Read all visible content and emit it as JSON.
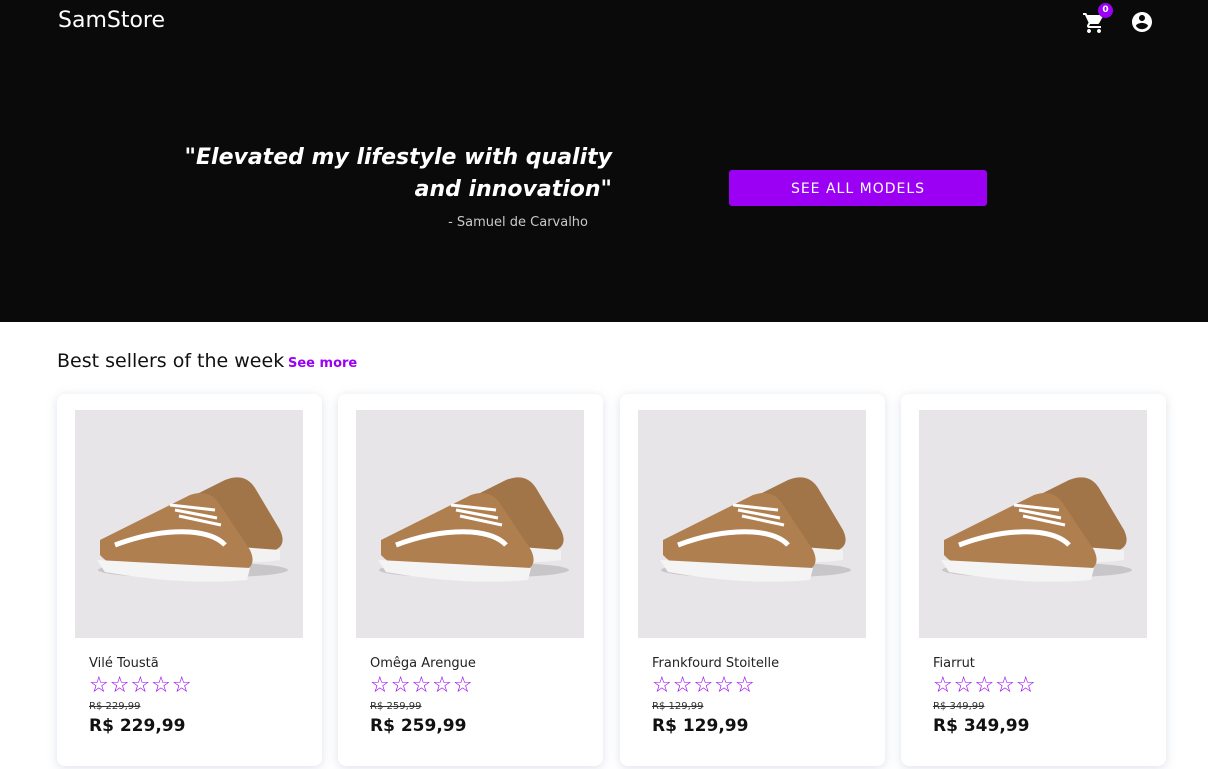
{
  "header": {
    "logo": "SamStore",
    "cart_count": "0",
    "cart_icon": "cart-icon",
    "account_icon": "account-circle-icon"
  },
  "hero": {
    "quote": "\"Elevated my lifestyle with quality and innovation\"",
    "author": "- Samuel de Carvalho",
    "cta_label": "SEE ALL MODELS"
  },
  "best_sellers": {
    "title": "Best sellers of the week",
    "see_more": "See more",
    "products": [
      {
        "name": "Vilé Toustã",
        "stars": "☆☆☆☆☆",
        "old_price": "R$ 229,99",
        "price": "R$ 229,99"
      },
      {
        "name": "Omêga Arengue",
        "stars": "☆☆☆☆☆",
        "old_price": "R$ 259,99",
        "price": "R$ 259,99"
      },
      {
        "name": "Frankfourd Stoitelle",
        "stars": "☆☆☆☆☆",
        "old_price": "R$ 129,99",
        "price": "R$ 129,99"
      },
      {
        "name": "Fiarrut",
        "stars": "☆☆☆☆☆",
        "old_price": "R$ 349,99",
        "price": "R$ 349,99"
      }
    ]
  },
  "colors": {
    "accent": "#9b00f5",
    "hero_bg": "#0a0a0b",
    "thumb_bg": "#e7e5e8"
  }
}
